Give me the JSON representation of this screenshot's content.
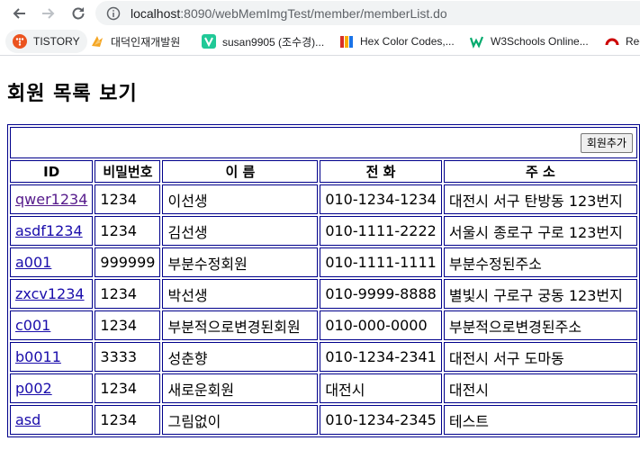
{
  "browser": {
    "url_host": "localhost",
    "url_path": ":8090/webMemImgTest/member/memberList.do"
  },
  "bookmarks": [
    {
      "label": "TISTORY",
      "icon": "tistory-icon"
    },
    {
      "label": "대덕인재개발원",
      "icon": "ddit-icon"
    },
    {
      "label": "susan9905 (조수경)...",
      "icon": "velog-icon"
    },
    {
      "label": "Hex Color Codes,...",
      "icon": "hex-color-icon"
    },
    {
      "label": "W3Schools Online...",
      "icon": "w3schools-icon"
    },
    {
      "label": "Red",
      "icon": "red-icon"
    }
  ],
  "page": {
    "title": "회원 목록 보기",
    "add_button": "회원추가"
  },
  "table": {
    "headers": [
      "ID",
      "비밀번호",
      "이 름",
      "전 화",
      "주 소"
    ],
    "rows": [
      {
        "id": "qwer1234",
        "pw": "1234",
        "name": "이선생",
        "phone": "010-1234-1234",
        "addr": "대전시 서구 탄방동 123번지"
      },
      {
        "id": "asdf1234",
        "pw": "1234",
        "name": "김선생",
        "phone": "010-1111-2222",
        "addr": "서울시 종로구 구로 123번지"
      },
      {
        "id": "a001",
        "pw": "999999",
        "name": "부분수정회원",
        "phone": "010-1111-1111",
        "addr": "부분수정된주소"
      },
      {
        "id": "zxcv1234",
        "pw": "1234",
        "name": "박선생",
        "phone": "010-9999-8888",
        "addr": "별빛시 구로구 궁동 123번지"
      },
      {
        "id": "c001",
        "pw": "1234",
        "name": "부분적으로변경된회원",
        "phone": "010-000-0000",
        "addr": "부분적으로변경된주소"
      },
      {
        "id": "b0011",
        "pw": "3333",
        "name": "성춘향",
        "phone": "010-1234-2341",
        "addr": "대전시 서구 도마동"
      },
      {
        "id": "p002",
        "pw": "1234",
        "name": "새로운회원",
        "phone": "대전시",
        "addr": "대전시"
      },
      {
        "id": "asd",
        "pw": "1234",
        "name": "그림없이",
        "phone": "010-1234-2345",
        "addr": "테스트"
      }
    ]
  },
  "colors": {
    "table_border": "#00008b",
    "link": "#1a0dab",
    "link_visited": "#551a8b"
  }
}
